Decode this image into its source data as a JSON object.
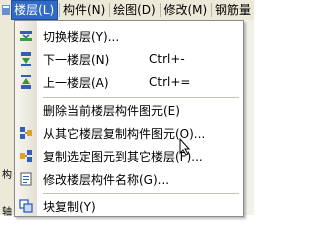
{
  "menubar": {
    "items": [
      {
        "label": "楼层(L)",
        "active": true
      },
      {
        "label": "构件(N)",
        "active": false
      },
      {
        "label": "绘图(D)",
        "active": false
      },
      {
        "label": "修改(M)",
        "active": false
      },
      {
        "label": "钢筋量",
        "active": false
      }
    ]
  },
  "background": {
    "right_chars": [
      "5",
      "",
      "",
      "",
      "",
      "",
      "",
      "",
      "",
      ""
    ]
  },
  "toolstrip": {
    "labels": [
      "构",
      "轴"
    ]
  },
  "menu": {
    "items": [
      {
        "label": "切换楼层(Y)...",
        "shortcut": "",
        "icon": "switch-floor-icon"
      },
      {
        "label": "下一楼层(N)",
        "shortcut": "Ctrl+-",
        "icon": "next-floor-icon"
      },
      {
        "label": "上一楼层(A)",
        "shortcut": "Ctrl+=",
        "icon": "prev-floor-icon"
      },
      {
        "label": "删除当前楼层构件图元(E)",
        "shortcut": "",
        "icon": "delete-floor-elements-icon"
      },
      {
        "label": "从其它楼层复制构件图元(O)...",
        "shortcut": "",
        "icon": "copy-from-floor-icon"
      },
      {
        "label": "复制选定图元到其它楼层(F)...",
        "shortcut": "",
        "icon": "copy-to-floor-icon"
      },
      {
        "label": "修改楼层构件名称(G)...",
        "shortcut": "",
        "icon": "rename-elements-icon"
      },
      {
        "label": "块复制(Y)",
        "shortcut": "",
        "icon": "block-copy-icon"
      }
    ]
  },
  "colors": {
    "highlight": "#316ac5",
    "menubar_bg": "#ece9d8"
  }
}
